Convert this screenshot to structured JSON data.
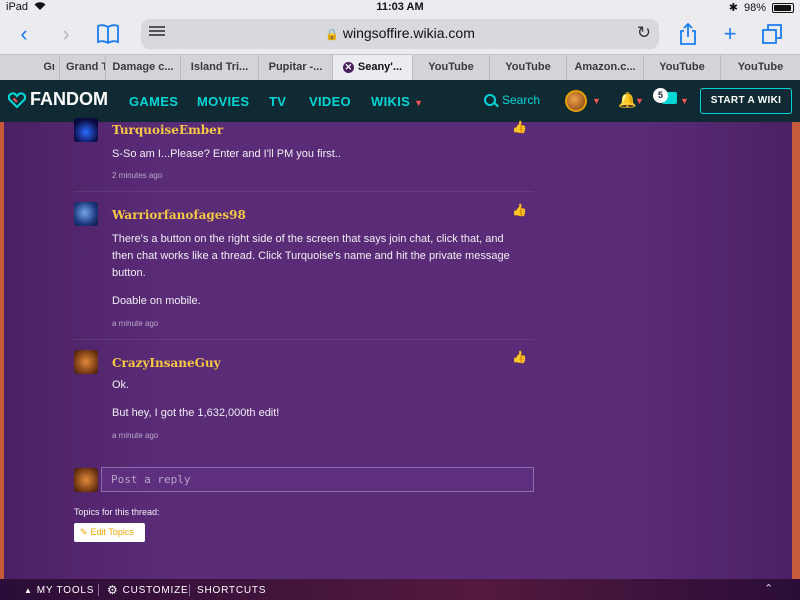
{
  "status_bar": {
    "device": "iPad",
    "time": "11:03 AM",
    "battery": "98%"
  },
  "browser": {
    "url": "wingsoffire.wikia.com",
    "tabs": [
      {
        "label": "Gı"
      },
      {
        "label": "Grand T"
      },
      {
        "label": "Damage c..."
      },
      {
        "label": "Island Tri..."
      },
      {
        "label": "Pupitar -..."
      },
      {
        "label": "Seany'...",
        "active": true
      },
      {
        "label": "YouTube"
      },
      {
        "label": "YouTube"
      },
      {
        "label": "Amazon.c..."
      },
      {
        "label": "YouTube"
      },
      {
        "label": "YouTube"
      }
    ]
  },
  "fandom": {
    "logo": "FANDOM",
    "nav": [
      "GAMES",
      "MOVIES",
      "TV",
      "VIDEO",
      "WIKIS"
    ],
    "search_label": "Search",
    "chat_badge": "5",
    "start_wiki": "START A WIKI"
  },
  "posts": [
    {
      "author": "TurquoiseEmber",
      "avatar": "fire",
      "paragraphs": [
        "S-So am I...Please? Enter and I'll PM you first.."
      ],
      "time": "2 minutes ago"
    },
    {
      "author": "Warriorfanofages98",
      "avatar": "globe",
      "paragraphs": [
        "There's a button on the right side of the screen that says join chat, click that, and then chat works like a thread. Click Turquoise's name and hit the private message button.",
        "Doable on mobile."
      ],
      "time": "a minute ago"
    },
    {
      "author": "CrazyInsaneGuy",
      "avatar": "lion",
      "paragraphs": [
        "Ok.",
        "But hey, I got the 1,632,000th edit!"
      ],
      "time": "a minute ago"
    }
  ],
  "reply": {
    "placeholder": "Post a reply"
  },
  "topics": {
    "label": "Topics for this thread:",
    "edit_button": "Edit Topics"
  },
  "bottom_bar": {
    "my_tools": "MY TOOLS",
    "customize": "CUSTOMIZE",
    "shortcuts": "SHORTCUTS"
  }
}
